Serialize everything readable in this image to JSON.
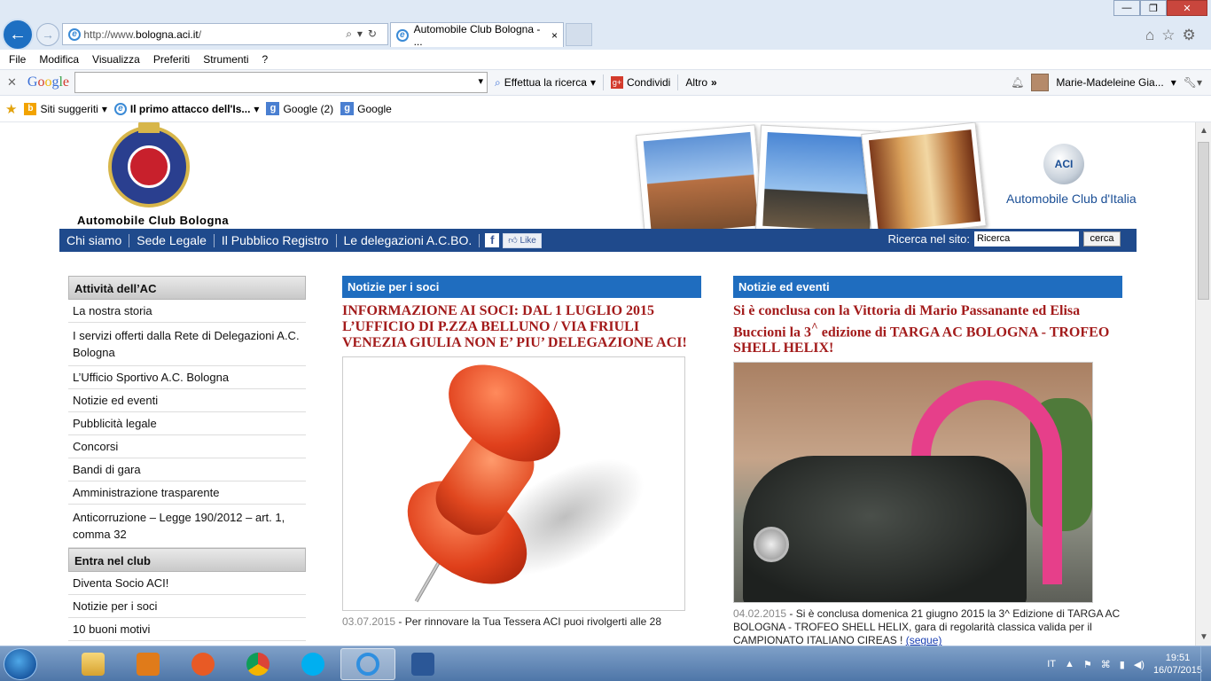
{
  "browser": {
    "url_prefix": "http://www.",
    "url_domain": "bologna.aci.it",
    "url_suffix": "/",
    "tab_title": "Automobile Club Bologna - ...",
    "menu": [
      "File",
      "Modifica",
      "Visualizza",
      "Preferiti",
      "Strumenti",
      "?"
    ]
  },
  "google_toolbar": {
    "logo": "Google",
    "search_label": "Effettua la ricerca",
    "share_label": "Condividi",
    "more_label": "Altro",
    "user_name": "Marie-Madeleine Gia..."
  },
  "favorites": [
    {
      "label": "Siti suggeriti",
      "dropdown": true,
      "icon": "bing-icon"
    },
    {
      "label": "Il primo attacco dell'Is...",
      "dropdown": true,
      "icon": "ie-page-icon"
    },
    {
      "label": "Google (2)",
      "dropdown": false,
      "icon": "google-icon"
    },
    {
      "label": "Google",
      "dropdown": false,
      "icon": "google-icon"
    }
  ],
  "site": {
    "club_name": "Automobile Club Bologna",
    "aci_logo": "ACI",
    "aci_name": "Automobile Club d'Italia",
    "nav": [
      "Chi siamo",
      "Sede Legale",
      "Il Pubblico Registro",
      "Le delegazioni A.C.BO."
    ],
    "fb_like": "Like",
    "search_label": "Ricerca nel sito:",
    "search_value": "Ricerca",
    "search_button": "cerca"
  },
  "sidebar": {
    "section1_title": "Attività dell’AC",
    "section1_items": [
      "La nostra storia",
      "I servizi offerti dalla Rete di Delegazioni A.C. Bologna",
      "L’Ufficio Sportivo A.C. Bologna",
      "Notizie ed eventi",
      "Pubblicità legale",
      "Concorsi",
      "Bandi di gara",
      "Amministrazione trasparente",
      "Anticorruzione – Legge 190/2012 – art. 1, comma 32"
    ],
    "section2_title": "Entra nel club",
    "section2_items": [
      "Diventa Socio ACI!",
      "Notizie per i soci",
      "10 buoni motivi"
    ]
  },
  "news_soci": {
    "heading": "Notizie per i soci",
    "title": "INFORMAZIONE AI SOCI: DAL 1 LUGLIO 2015 L’UFFICIO DI P.ZZA BELLUNO / VIA FRIULI VENEZIA GIULIA NON E’ PIU’ DELEGAZIONE ACI!",
    "date": "03.07.2015",
    "excerpt": " - Per rinnovare la Tua Tessera ACI puoi rivolgerti alle 28"
  },
  "news_eventi": {
    "heading": "Notizie ed eventi",
    "title_a": "Si è conclusa con la Vittoria di Mario Passanante ed Elisa Buccioni la 3",
    "title_sup": "^",
    "title_b": " edizione di TARGA AC BOLOGNA - TROFEO SHELL HELIX!",
    "date": "04.02.2015",
    "excerpt": " - Si è conclusa domenica 21 giugno 2015 la 3^ Edizione di TARGA AC BOLOGNA - TROFEO SHELL HELIX, gara di regolarità classica valida per il CAMPIONATO ITALIANO CIREAS ! ",
    "more": "(segue)"
  },
  "taskbar": {
    "lang": "IT",
    "time": "19:51",
    "date": "16/07/2015",
    "apps": [
      "explorer-icon",
      "outlook-icon",
      "media-player-icon",
      "chrome-icon",
      "skype-icon",
      "internet-explorer-icon",
      "word-icon"
    ]
  }
}
